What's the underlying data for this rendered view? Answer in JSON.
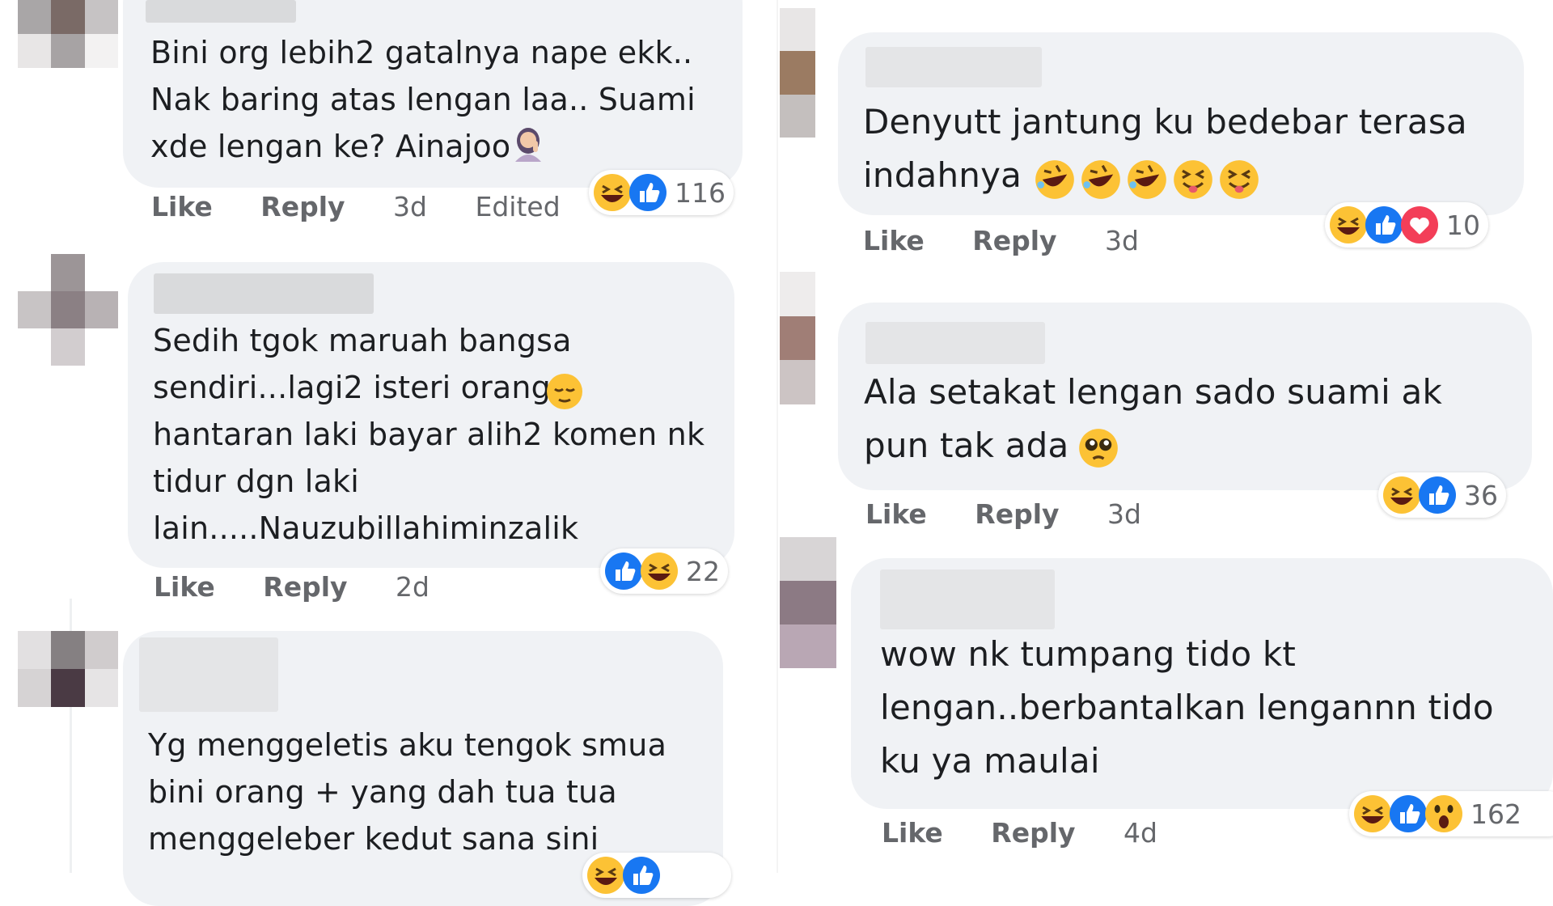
{
  "left": {
    "comments": [
      {
        "text": "Bini org lebih2 gatalnya nape ekk..\nNak baring atas lengan laa.. Suami\nxde lengan ke? Ainajoo",
        "like": "Like",
        "reply": "Reply",
        "time": "3d",
        "edited": "Edited",
        "reaction_count": "116",
        "reaction_icons": [
          "laugh-icon",
          "like-icon"
        ]
      },
      {
        "text": "Sedih tgok maruah bangsa\nsendiri...lagi2 isteri orang\nhantaran laki bayar alih2 komen nk\ntidur dgn laki\nlain.....Nauzubillahiminzalik",
        "like": "Like",
        "reply": "Reply",
        "time": "2d",
        "reaction_count": "22",
        "reaction_icons": [
          "like-icon",
          "laugh-icon"
        ]
      },
      {
        "text": "Yg menggeletis aku tengok smua\nbini orang + yang dah tua tua\nmenggeleber kedut sana sini",
        "reaction_icons": [
          "laugh-icon",
          "like-icon"
        ]
      }
    ]
  },
  "right": {
    "comments": [
      {
        "text": "Denyutt jantung ku bedebar terasa\nindahnya",
        "like": "Like",
        "reply": "Reply",
        "time": "3d",
        "reaction_count": "10",
        "reaction_icons": [
          "laugh-icon",
          "like-icon",
          "love-icon"
        ]
      },
      {
        "text": "Ala setakat lengan sado suami ak\npun tak ada",
        "like": "Like",
        "reply": "Reply",
        "time": "3d",
        "reaction_count": "36",
        "reaction_icons": [
          "laugh-icon",
          "like-icon"
        ]
      },
      {
        "text": "wow nk tumpang tido kt\nlengan..berbantalkan lengannn tido\nku ya maulai",
        "like": "Like",
        "reply": "Reply",
        "time": "4d",
        "reaction_count": "162",
        "reaction_icons": [
          "laugh-icon",
          "like-icon",
          "wow-icon"
        ]
      }
    ]
  },
  "colors": {
    "bubble": "#f0f2f5",
    "action_text": "#65676b",
    "like_blue": "#1877f2",
    "love_red": "#f33e58",
    "emoji_yellow": "#fcc235"
  }
}
